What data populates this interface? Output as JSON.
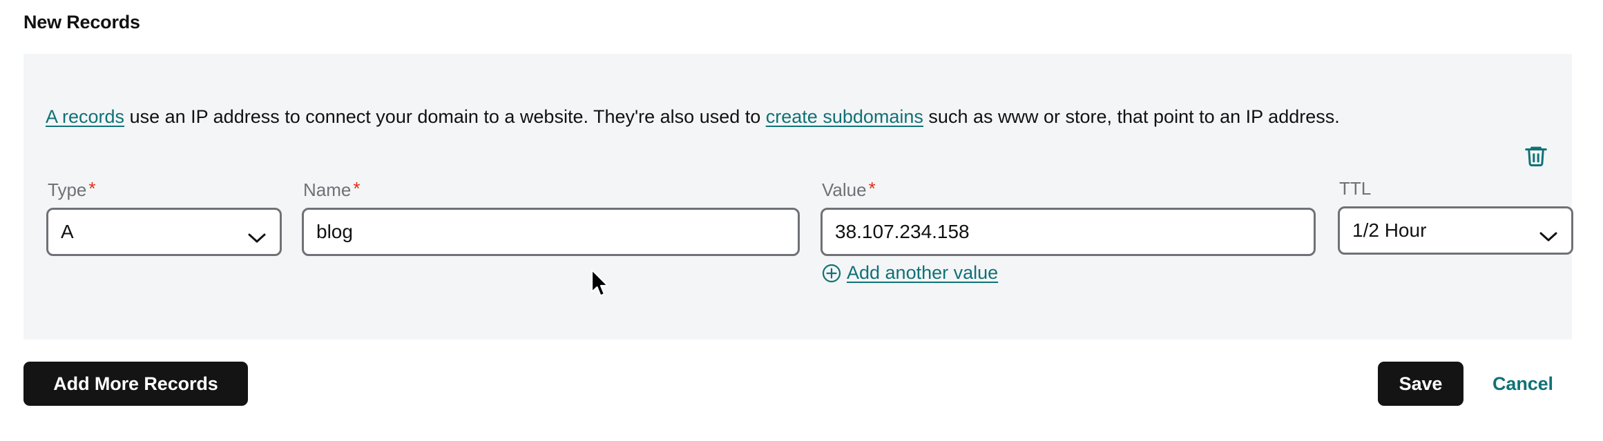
{
  "section": {
    "title": "New Records"
  },
  "record": {
    "description": {
      "link1_text": "A records",
      "part1": " use an IP address to connect your domain to a website. They're also used to ",
      "link2_text": "create subdomains",
      "part2": " such as www or store, that point to an IP address."
    },
    "delete_icon": "trash-icon",
    "fields": {
      "type": {
        "label": "Type",
        "required_marker": "*",
        "value": "A",
        "chevron_icon": "chevron-down-icon"
      },
      "name": {
        "label": "Name",
        "required_marker": "*",
        "value": "blog",
        "placeholder": ""
      },
      "value": {
        "label": "Value",
        "required_marker": "*",
        "value": "38.107.234.158",
        "placeholder": "",
        "add_another_label": "Add another value",
        "add_another_icon": "plus-circle-icon"
      },
      "ttl": {
        "label": "TTL",
        "value": "1/2 Hour",
        "chevron_icon": "chevron-down-icon"
      }
    }
  },
  "footer": {
    "add_more_records_label": "Add More Records",
    "save_label": "Save",
    "cancel_label": "Cancel"
  },
  "colors": {
    "accent_teal": "#0f7276",
    "required_red": "#e32b11",
    "card_background": "#f4f5f7",
    "button_dark": "#141414",
    "label_gray": "#6f7176",
    "border_gray": "#6f7176"
  }
}
